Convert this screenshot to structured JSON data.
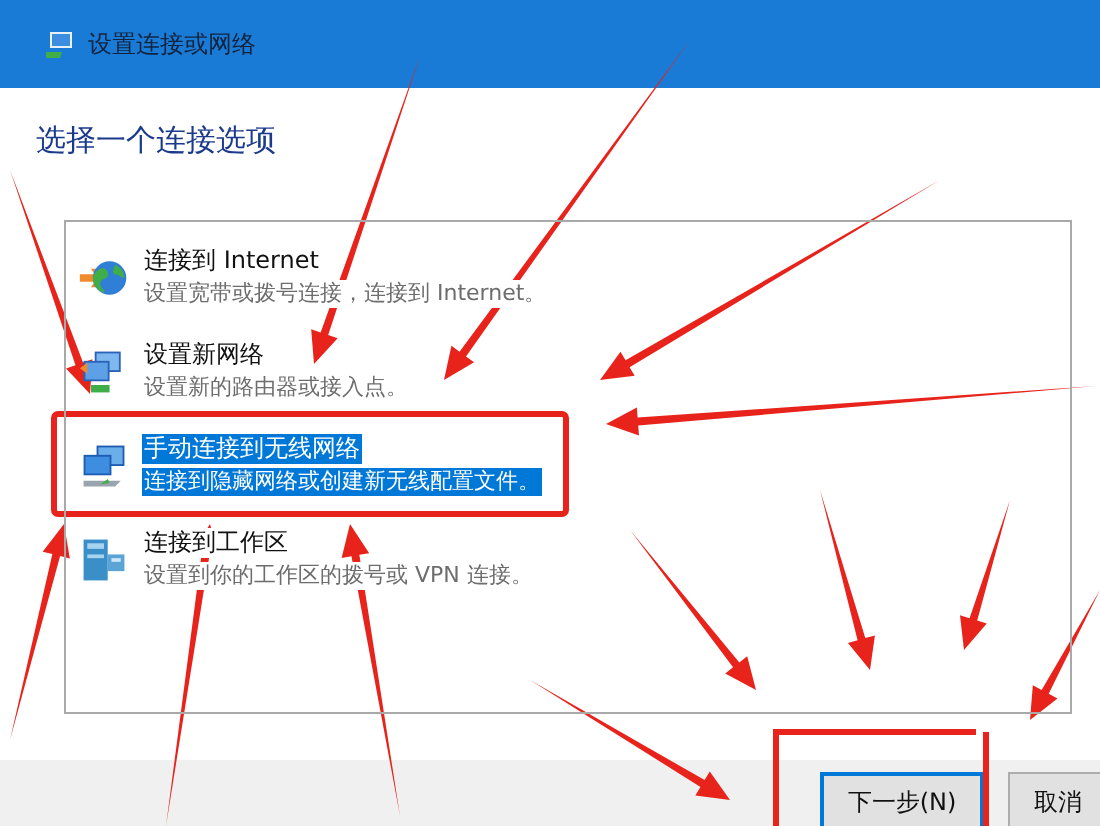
{
  "window": {
    "title": "设置连接或网络"
  },
  "heading": "选择一个连接选项",
  "options": [
    {
      "kind": "globe",
      "title": "连接到 Internet",
      "description": "设置宽带或拨号连接，连接到 Internet。",
      "selected": false
    },
    {
      "kind": "network",
      "title": "设置新网络",
      "description": "设置新的路由器或接入点。",
      "selected": false
    },
    {
      "kind": "monitor",
      "title": "手动连接到无线网络",
      "description": "连接到隐藏网络或创建新无线配置文件。",
      "selected": true
    },
    {
      "kind": "workplace",
      "title": "连接到工作区",
      "description": "设置到你的工作区的拨号或 VPN 连接。",
      "selected": false
    }
  ],
  "buttons": [
    {
      "label": "下一步(N)",
      "kind": "default"
    },
    {
      "label": "取消",
      "kind": "normal"
    }
  ]
}
